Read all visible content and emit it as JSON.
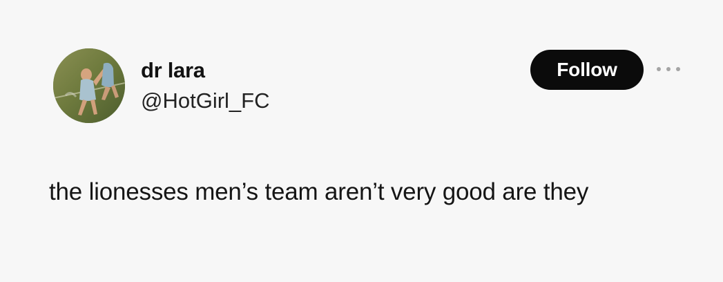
{
  "tweet": {
    "display_name": "dr lara",
    "handle": "@HotGirl_FC",
    "follow_label": "Follow",
    "text": "the lionesses men’s team aren’t very good are they"
  },
  "icons": {
    "more": "more-horizontal-icon"
  }
}
